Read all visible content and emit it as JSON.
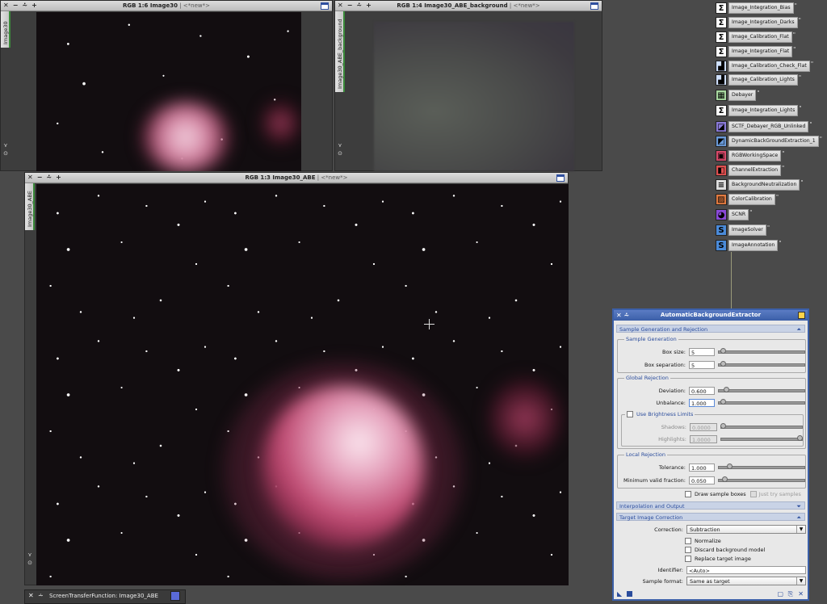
{
  "windows": {
    "image30": {
      "title": "RGB 1:6 Image30",
      "sub": "| <*new*>",
      "tab": "Image30"
    },
    "background": {
      "title": "RGB 1:4 Image30_ABE_background",
      "sub": "| <*new*>",
      "tab": "Image30_ABE_background"
    },
    "abe": {
      "title": "RGB 1:3 Image30_ABE",
      "sub": "| <*new*>",
      "tab": "Image30_ABE"
    }
  },
  "window_buttons": {
    "close": "✕",
    "minimize": "−",
    "shade": "⩪",
    "maximize": "+"
  },
  "process_icons": [
    {
      "label": "Image_Integration_Bias",
      "icon": "sigma-icon",
      "glyph": "Σ",
      "color": "#ffffff"
    },
    {
      "label": "Image_Integration_Darks",
      "icon": "sigma-icon",
      "glyph": "Σ",
      "color": "#ffffff"
    },
    {
      "label": "Image_Calibration_Flat",
      "icon": "sigma-icon",
      "glyph": "Σ",
      "color": "#ffffff"
    },
    {
      "label": "Image_Integration_Flat",
      "icon": "sigma-icon",
      "glyph": "Σ",
      "color": "#ffffff"
    },
    {
      "label": "Image_Calibration_Check_Flat",
      "icon": "calibration-icon",
      "glyph": "▟",
      "color": "#cfe0ff"
    },
    {
      "label": "Image_Calibration_Lights",
      "icon": "calibration-icon",
      "glyph": "▟",
      "color": "#cfe0ff"
    },
    {
      "label": "Debayer",
      "icon": "debayer-icon",
      "glyph": "▦",
      "color": "#a8d8a0"
    },
    {
      "label": "Image_Integration_Lights",
      "icon": "sigma-icon",
      "glyph": "Σ",
      "color": "#ffffff"
    },
    {
      "label": "SCTF_Debayer_RGB_Unlinked",
      "icon": "stf-icon",
      "glyph": "◪",
      "color": "#8a7ad8"
    },
    {
      "label": "DynamicBackGroundExtraction_1",
      "icon": "dbe-icon",
      "glyph": "◩",
      "color": "#6a9ad8"
    },
    {
      "label": "RGBWorkingSpace",
      "icon": "rgb-icon",
      "glyph": "▣",
      "color": "#d84a6a"
    },
    {
      "label": "ChannelExtraction",
      "icon": "channel-icon",
      "glyph": "◧",
      "color": "#e05050"
    },
    {
      "label": "BackgroundNeutralization",
      "icon": "neutralization-icon",
      "glyph": "≡",
      "color": "#dddddd"
    },
    {
      "label": "ColorCalibration",
      "icon": "color-calibration-icon",
      "glyph": "▨",
      "color": "#e07a40"
    },
    {
      "label": "SCNR",
      "icon": "scnr-icon",
      "glyph": "◕",
      "color": "#8a4ad8"
    },
    {
      "label": "ImageSolver",
      "icon": "solver-icon",
      "glyph": "S",
      "color": "#4a8ad8"
    },
    {
      "label": "ImageAnnotation",
      "icon": "annotation-icon",
      "glyph": "S",
      "color": "#4a8ad8"
    }
  ],
  "abe_dialog": {
    "title": "AutomaticBackgroundExtractor",
    "section_sample": "Sample Generation and Rejection",
    "group_sample_generation": "Sample Generation",
    "box_size_label": "Box size:",
    "box_size": "5",
    "box_separation_label": "Box separation:",
    "box_separation": "5",
    "group_global_rejection": "Global Rejection",
    "deviation_label": "Deviation:",
    "deviation": "0.600",
    "unbalance_label": "Unbalance:",
    "unbalance": "1.000",
    "use_brightness_label": "Use Brightness Limits",
    "shadows_label": "Shadows:",
    "shadows": "0.0000",
    "highlights_label": "Highlights:",
    "highlights": "1.0000",
    "group_local_rejection": "Local Rejection",
    "tolerance_label": "Tolerance:",
    "tolerance": "1.000",
    "min_valid_label": "Minimum valid fraction:",
    "min_valid": "0.050",
    "draw_samples_label": "Draw sample boxes",
    "just_try_label": "Just try samples",
    "section_interp": "Interpolation and Output",
    "section_target": "Target Image Correction",
    "correction_label": "Correction:",
    "correction": "Subtraction",
    "normalize_label": "Normalize",
    "discard_label": "Discard background model",
    "replace_label": "Replace target image",
    "identifier_label": "Identifier:",
    "identifier": "<Auto>",
    "sample_format_label": "Sample format:",
    "sample_format": "Same as target"
  },
  "stf_bar": {
    "title": "ScreenTransferFunction: Image30_ABE"
  }
}
